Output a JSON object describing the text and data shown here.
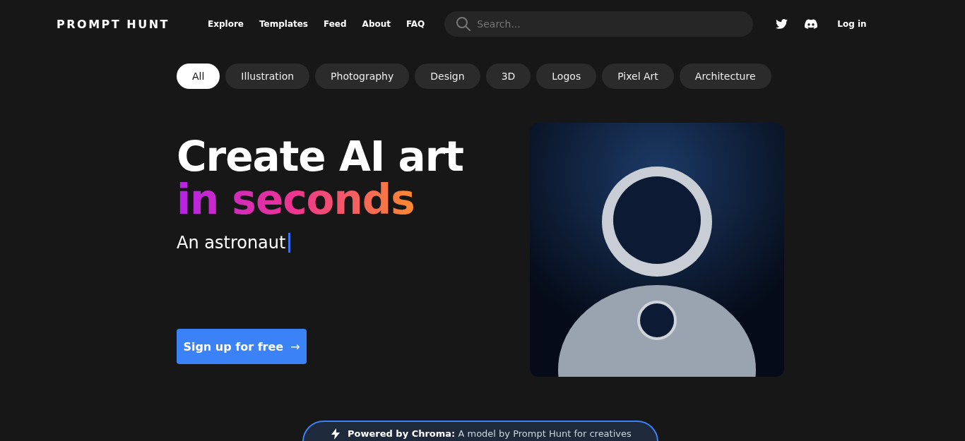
{
  "header": {
    "logo": "PROMPT HUNT",
    "nav": [
      "Explore",
      "Templates",
      "Feed",
      "About",
      "FAQ"
    ],
    "search": {
      "placeholder": "Search..."
    },
    "login": "Log in"
  },
  "categories": [
    {
      "label": "All",
      "selected": true
    },
    {
      "label": "Illustration",
      "selected": false
    },
    {
      "label": "Photography",
      "selected": false
    },
    {
      "label": "Design",
      "selected": false
    },
    {
      "label": "3D",
      "selected": false
    },
    {
      "label": "Logos",
      "selected": false
    },
    {
      "label": "Pixel Art",
      "selected": false
    },
    {
      "label": "Architecture",
      "selected": false
    }
  ],
  "hero": {
    "title_line_1": "Create AI art",
    "title_line_2": "in seconds",
    "prompt_text": "An astronaut",
    "cta": "Sign up for free",
    "cta_arrow": "→"
  },
  "banner": {
    "text": "**Powered by Chroma:** A model by Prompt Hunt for creatives"
  }
}
